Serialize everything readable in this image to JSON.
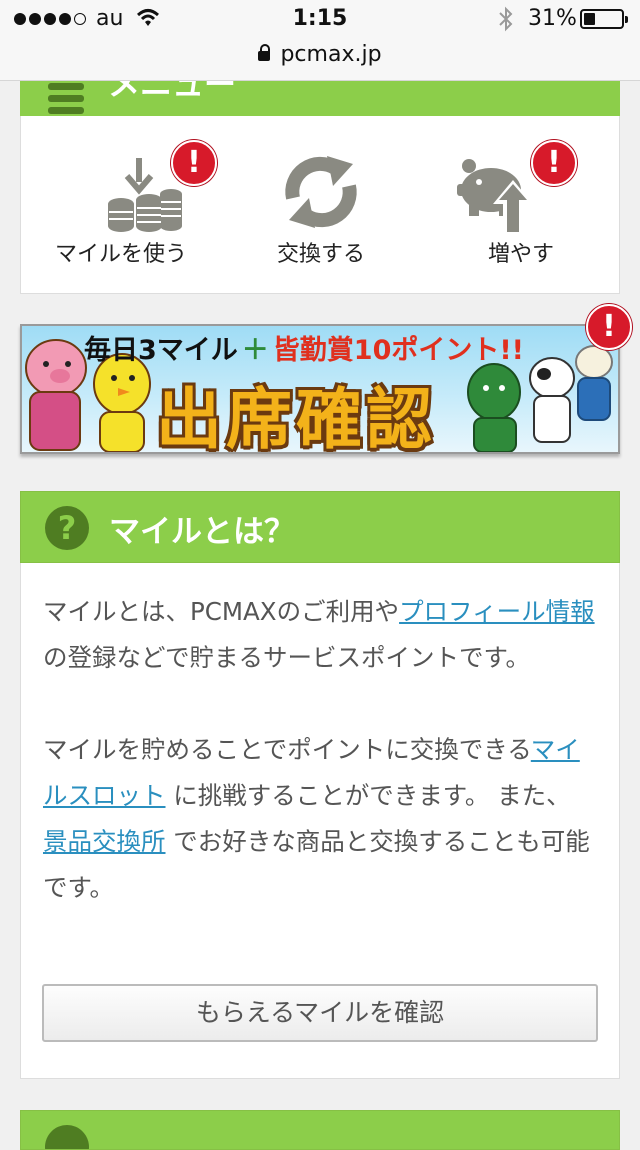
{
  "status_bar": {
    "carrier": "au",
    "time": "1:15",
    "battery_percent_text": "31%",
    "battery_level": 0.31,
    "url": "pcmax.jp"
  },
  "menu": {
    "title": "メニュー",
    "items": [
      {
        "label": "マイルを使う",
        "icon": "coins-download-icon",
        "alert": "!"
      },
      {
        "label": "交換する",
        "icon": "exchange-arrows-icon"
      },
      {
        "label": "増やす",
        "icon": "piggy-bank-up-icon",
        "alert": "!"
      }
    ]
  },
  "banner": {
    "top_text_1": "毎日3マイル",
    "plus": "＋",
    "top_text_2": "皆勤賞10ポイント!!",
    "main_text": "出席確認",
    "alert": "!"
  },
  "mile_info": {
    "title": "マイルとは？",
    "p1_a": "マイルとは、PCMAXのご利用や",
    "p1_link": "プロフィール情報",
    "p1_b": "の登録などで貯まるサービスポイントです。",
    "p2_a": "マイルを貯めることでポイントに交換できる",
    "p2_link1": "マイルスロット",
    "p2_b": "に挑戦することができます。 また、",
    "p2_link2": "景品交換所",
    "p2_c": "でお好きな商品と交換することも可能です。",
    "button_label": "もらえるマイルを確認"
  },
  "colors": {
    "accent_green": "#8cce4a",
    "dark_green": "#4f7d22",
    "alert_red": "#d71a2a",
    "link_blue": "#2a8fbf"
  }
}
